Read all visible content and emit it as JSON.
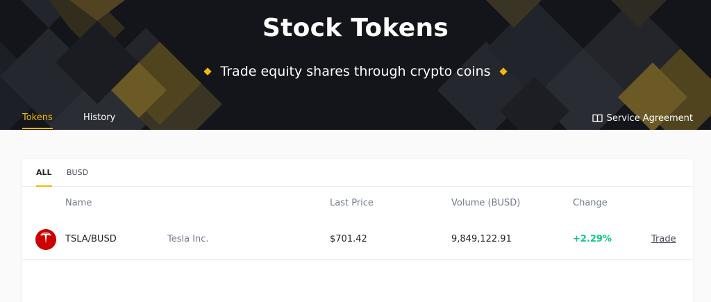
{
  "hero": {
    "title": "Stock Tokens",
    "subtitle": "Trade equity shares through crypto coins"
  },
  "nav": {
    "tabs": [
      {
        "label": "Tokens",
        "active": true
      },
      {
        "label": "History",
        "active": false
      }
    ],
    "service_agreement": "Service Agreement"
  },
  "filters": {
    "tabs": [
      {
        "label": "ALL",
        "active": true
      },
      {
        "label": "BUSD",
        "active": false
      }
    ]
  },
  "table": {
    "columns": [
      "Name",
      "Last Price",
      "Volume (BUSD)",
      "Change"
    ],
    "rows": [
      {
        "logo": "tesla-logo",
        "pair": "TSLA/BUSD",
        "company": "Tesla Inc.",
        "last_price": "$701.42",
        "volume": "9,849,122.91",
        "change": "+2.29%",
        "action": "Trade"
      }
    ]
  },
  "colors": {
    "accent": "#f0b90b",
    "hero_bg": "#14151a",
    "positive": "#0ecb81",
    "tesla_red": "#cc0000"
  },
  "icons": {
    "bullet": "diamond-icon",
    "service": "book-icon"
  }
}
